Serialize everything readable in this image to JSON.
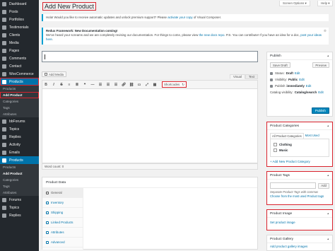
{
  "sidebar": {
    "items": [
      {
        "label": "Dashboard",
        "icon": "dashboard-icon"
      },
      {
        "label": "Posts",
        "icon": "pin-icon"
      },
      {
        "label": "Portfolios",
        "icon": "portfolio-icon"
      },
      {
        "label": "Testimonials",
        "icon": "quote-icon"
      },
      {
        "label": "Clients",
        "icon": "clients-icon"
      },
      {
        "label": "Media",
        "icon": "media-icon"
      },
      {
        "label": "Pages",
        "icon": "page-icon"
      },
      {
        "label": "Comments",
        "icon": "comment-icon"
      },
      {
        "label": "Contact",
        "icon": "mail-icon"
      },
      {
        "label": "WooCommerce",
        "icon": "woocommerce-icon"
      },
      {
        "label": "Products",
        "icon": "products-icon"
      }
    ],
    "products_sub": [
      "Products",
      "Add Product",
      "Categories",
      "Tags",
      "Attributes"
    ],
    "items2": [
      {
        "label": "bbForums",
        "icon": "forums-icon"
      },
      {
        "label": "Topics",
        "icon": "topics-icon"
      },
      {
        "label": "Replies",
        "icon": "replies-icon"
      },
      {
        "label": "Activity",
        "icon": "activity-icon"
      },
      {
        "label": "Emails",
        "icon": "emails-icon"
      },
      {
        "label": "Products",
        "icon": "products-icon"
      }
    ],
    "products_sub2": [
      "Products",
      "Add Product",
      "Categories",
      "Tags",
      "Attributes"
    ],
    "items3": [
      {
        "label": "Forums",
        "icon": "forums-icon"
      },
      {
        "label": "Topics",
        "icon": "topics-icon"
      },
      {
        "label": "Replies",
        "icon": "replies-icon"
      }
    ]
  },
  "header": {
    "title": "Add New Product",
    "screen_options": "Screen Options ▾",
    "help": "Help ▾"
  },
  "notice1": {
    "before": "Hola! Would you like to receive automatic updates and unlock premium support? Please ",
    "link": "activate your copy",
    "after": " of Visual Composer."
  },
  "notice2": {
    "heading": "Redux Framework: New Documentation coming!",
    "line1": "We've heard your screams and we are completely revising our documentation. For things to come, please view ",
    "link1": "the new docs repo",
    "line1b": ". P.S. You can contribute! If you have an idea for a doc, ",
    "link2": "post your ideas here",
    "line2b": "."
  },
  "editor": {
    "add_media": "Add Media",
    "tab_visual": "Visual",
    "tab_text": "Text",
    "shortcodes": "Shortcodes",
    "word_count": "Word count: 0"
  },
  "product_data": {
    "title": "Product Data",
    "tabs": [
      "General",
      "Inventory",
      "Shipping",
      "Linked Products",
      "Attributes",
      "Advanced"
    ]
  },
  "publish": {
    "title": "Publish",
    "save_draft": "Save Draft",
    "preview": "Preview",
    "status_label": "Status:",
    "status_value": "Draft",
    "edit": "Edit",
    "visibility_label": "Visibility:",
    "visibility_value": "Public",
    "publish_label": "Publish",
    "publish_value": "immediately",
    "catalog_label": "Catalog visibility:",
    "catalog_value": "Catalog/search",
    "publish_button": "Publish"
  },
  "categories": {
    "title": "Product Categories",
    "tab_all": "All Product Categories",
    "tab_used": "Most Used",
    "items": [
      "Clothing",
      "Music"
    ],
    "add_new": "+ Add New Product Category"
  },
  "tags": {
    "title": "Product Tags",
    "add": "Add",
    "hint": "Separate Product Tags with commas",
    "choose": "Choose from the most used Product tags"
  },
  "image": {
    "title": "Product Image",
    "set": "Set product image"
  },
  "gallery": {
    "title": "Product Gallery",
    "add": "Add product gallery images"
  },
  "colors": {
    "sidebar": "#23282d",
    "accent": "#0073aa",
    "highlight": "#d9232d"
  }
}
